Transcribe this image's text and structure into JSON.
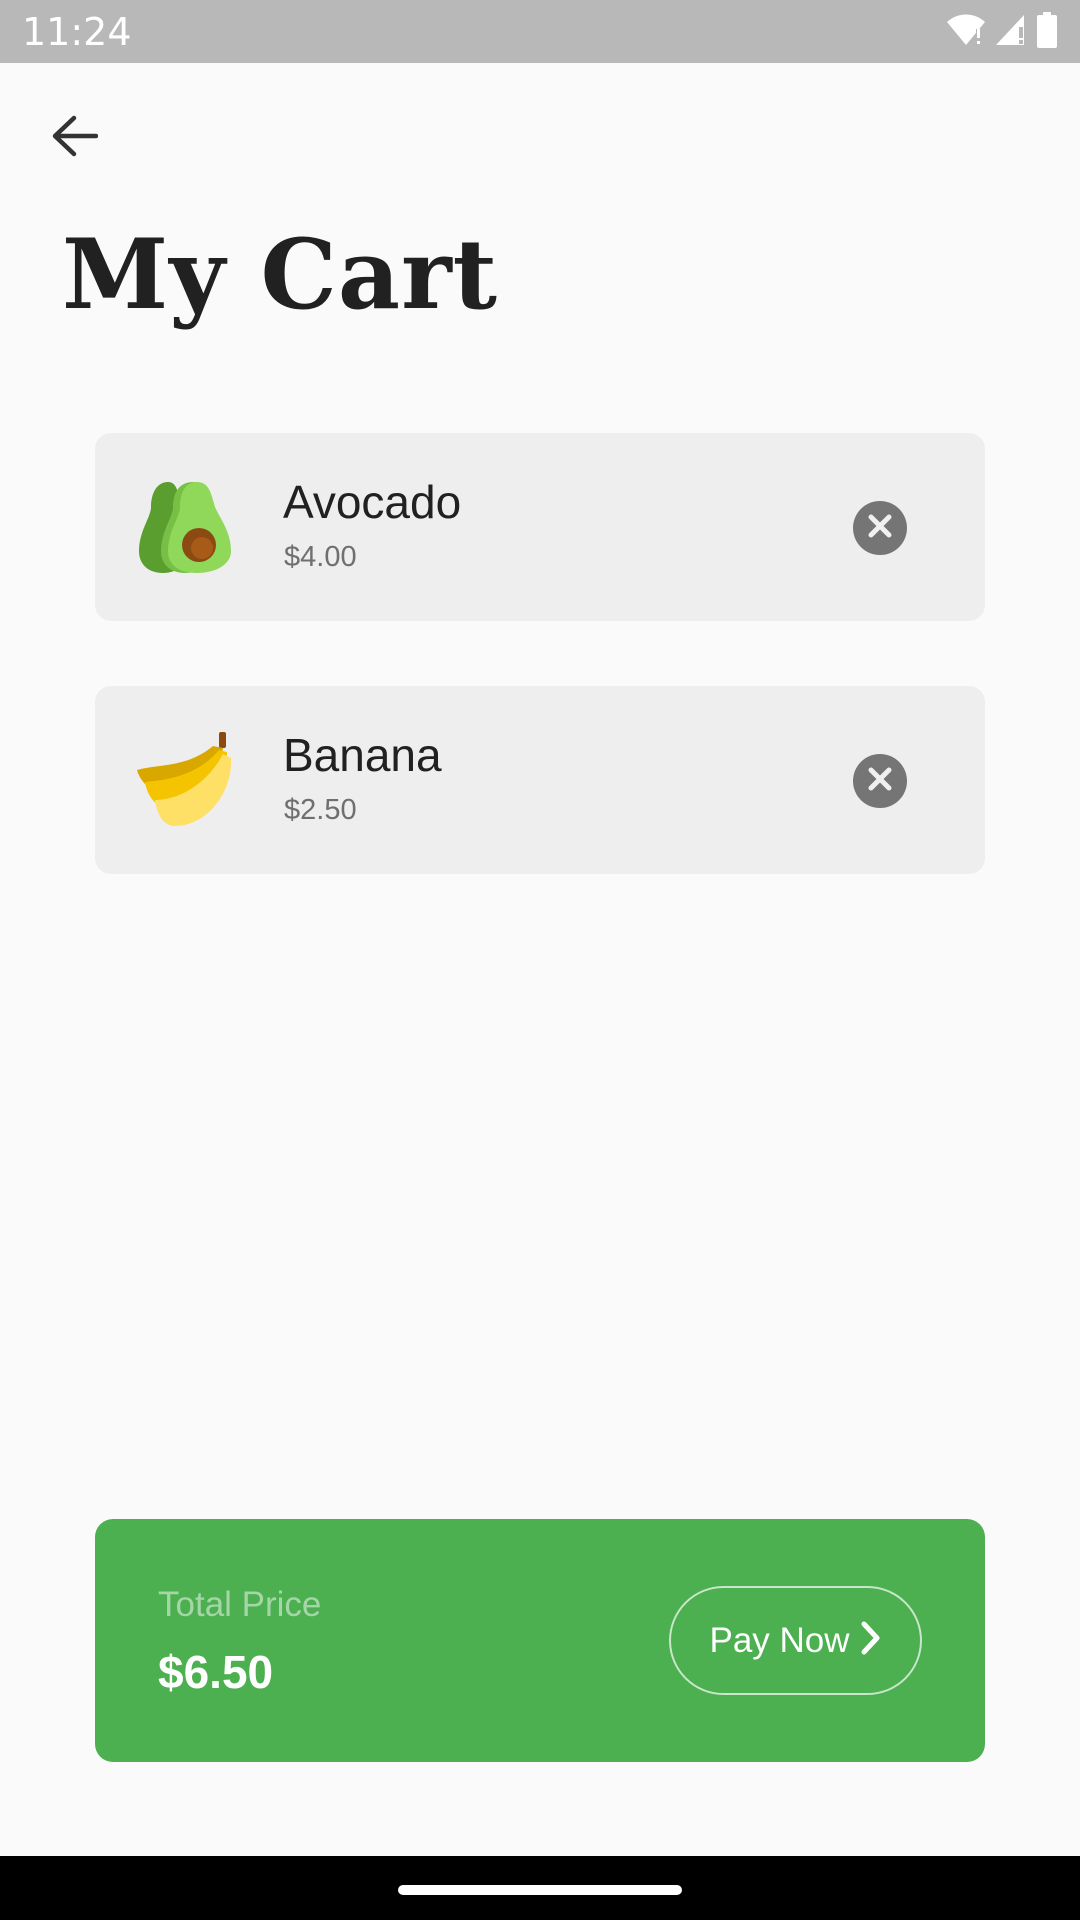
{
  "status_bar": {
    "time": "11:24",
    "icons": [
      "wifi-icon",
      "cell-signal-icon",
      "battery-icon"
    ]
  },
  "header": {
    "back_icon": "arrow-left-icon",
    "title": "My Cart"
  },
  "cart": {
    "items": [
      {
        "name": "Avocado",
        "price": "$4.00",
        "image": "avocado-icon",
        "remove_icon": "close-circle-icon"
      },
      {
        "name": "Banana",
        "price": "$2.50",
        "image": "banana-icon",
        "remove_icon": "close-circle-icon"
      }
    ]
  },
  "summary": {
    "label": "Total Price",
    "value": "$6.50",
    "pay_label": "Pay Now",
    "pay_icon": "chevron-right-icon"
  },
  "colors": {
    "accent": "#4caf50",
    "card_bg": "#eeeeee",
    "remove_button": "#757575",
    "status_bar": "#b8b8b8"
  }
}
